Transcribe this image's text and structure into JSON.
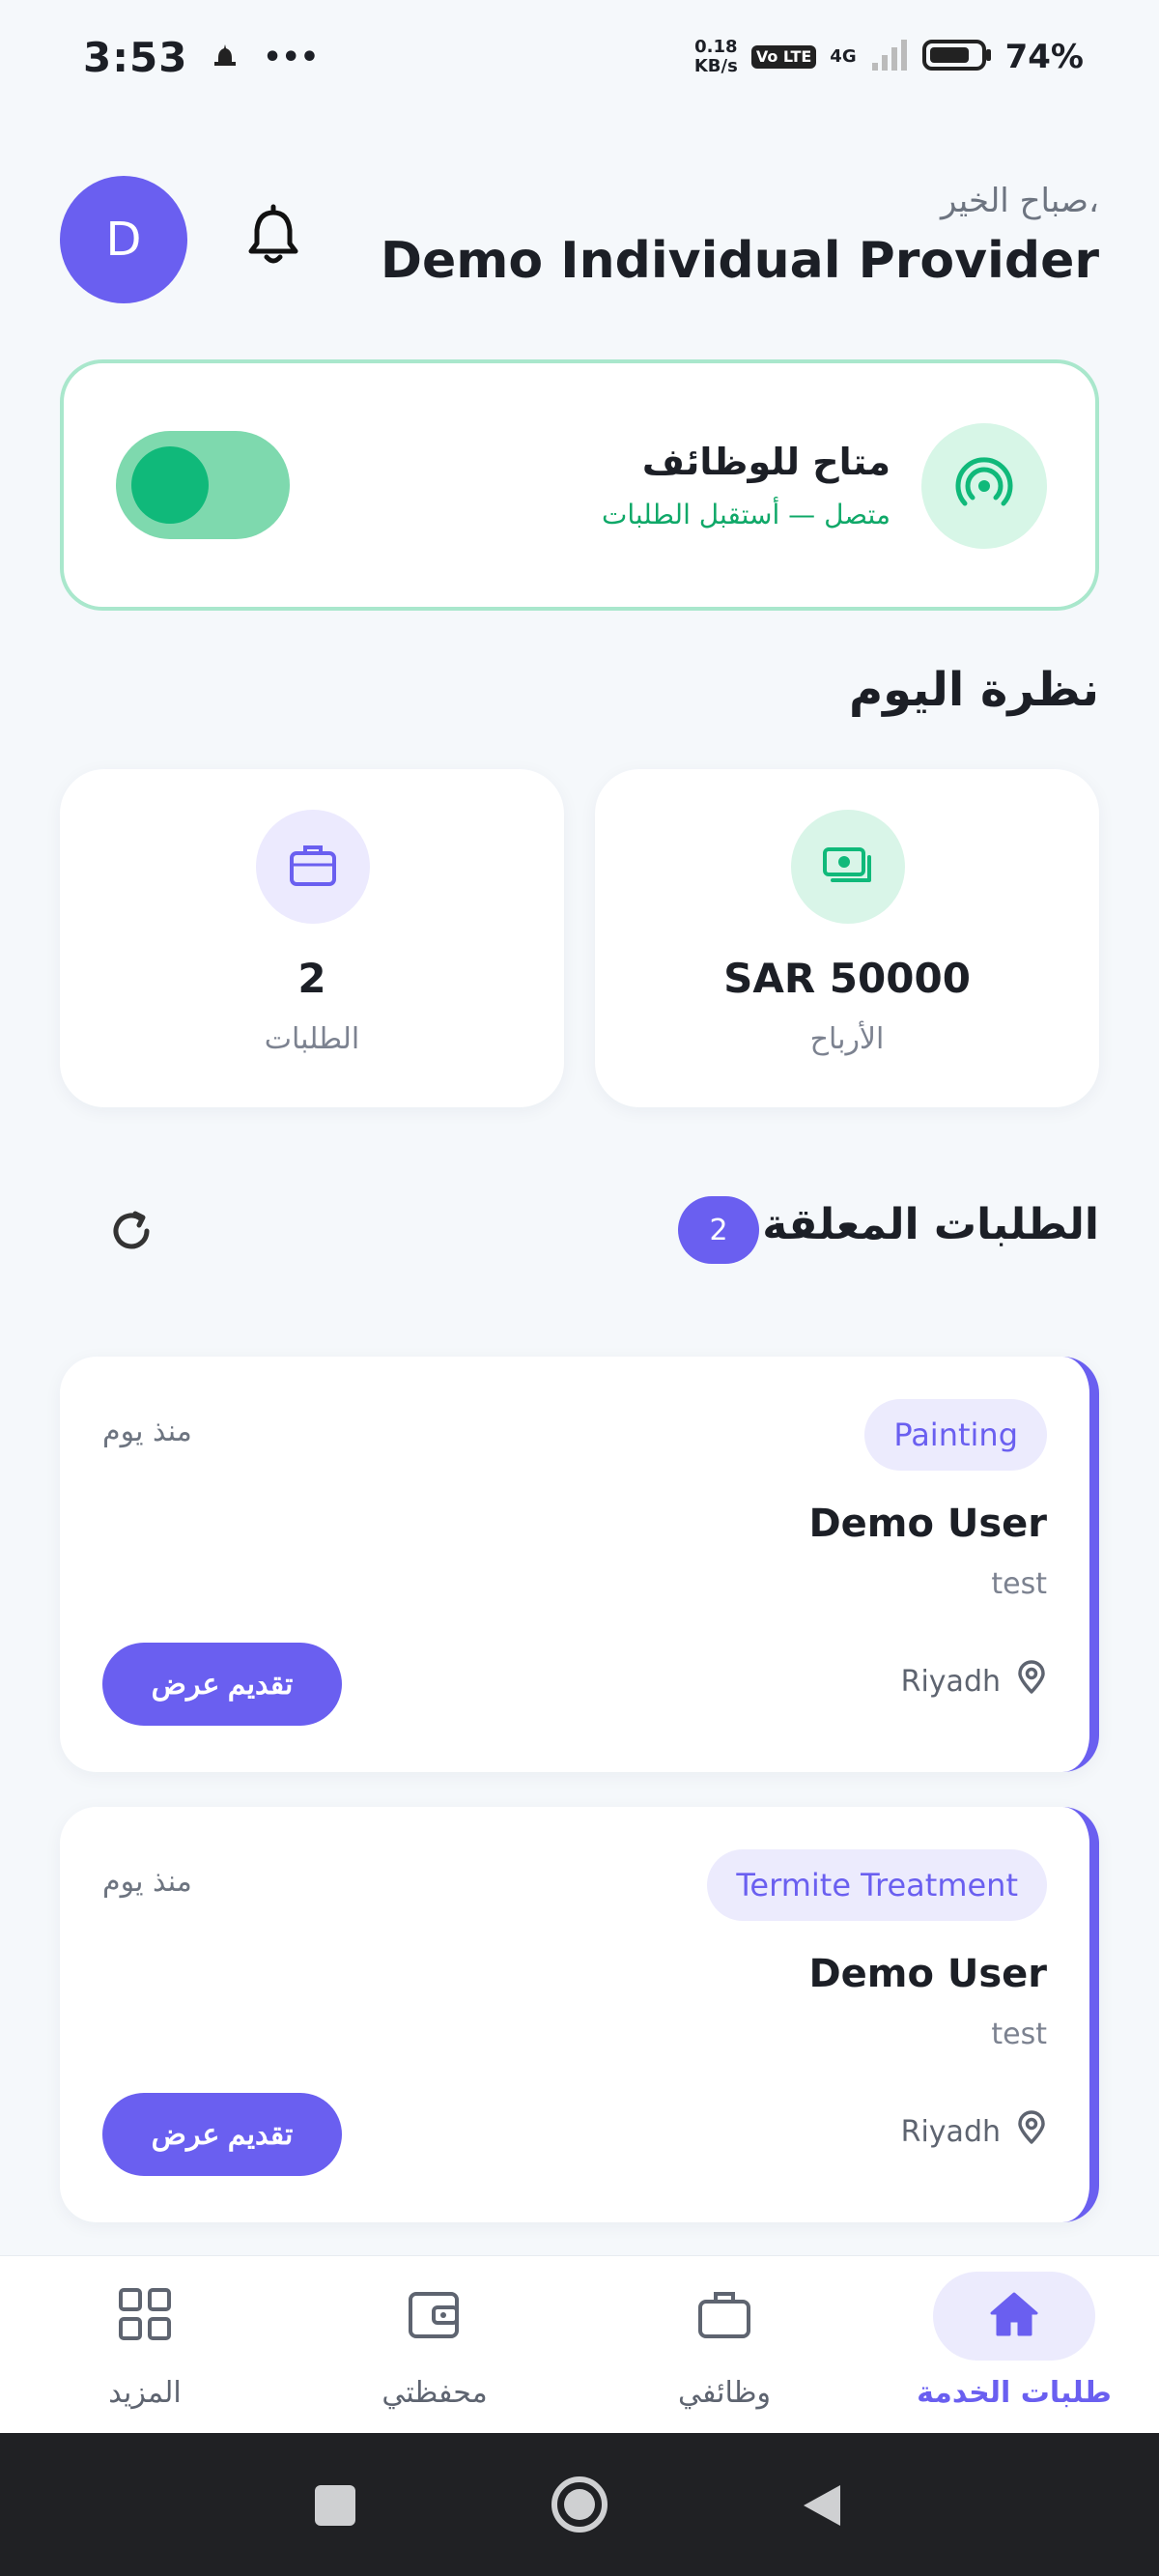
{
  "status_bar": {
    "time": "3:53",
    "notification_icons": "•••",
    "net_speed_value": "0.18",
    "net_speed_unit": "KB/s",
    "volte": "Vo LTE",
    "network": "4G",
    "battery": "74%"
  },
  "header": {
    "avatar_letter": "D",
    "greeting": "صباح الخير،",
    "provider_name": "Demo Individual Provider"
  },
  "availability": {
    "title": "متاح للوظائف",
    "subtitle": "متصل — أستقبل الطلبات",
    "toggle_on": true
  },
  "today": {
    "title": "نظرة اليوم",
    "earnings": {
      "value": "SAR 50000",
      "label": "الأرباح"
    },
    "requests": {
      "value": "2",
      "label": "الطلبات"
    }
  },
  "pending": {
    "title": "الطلبات المعلقة",
    "count": "2",
    "requests": [
      {
        "service": "Painting",
        "time_ago": "منذ يوم",
        "user": "Demo User",
        "description": "test",
        "location": "Riyadh",
        "action": "تقديم عرض"
      },
      {
        "service": "Termite Treatment",
        "time_ago": "منذ يوم",
        "user": "Demo User",
        "description": "test",
        "location": "Riyadh",
        "action": "تقديم عرض"
      }
    ]
  },
  "bottom_nav": {
    "items": [
      {
        "label": "طلبات الخدمة",
        "icon": "home-icon",
        "active": true
      },
      {
        "label": "وظائفي",
        "icon": "briefcase-icon",
        "active": false
      },
      {
        "label": "محفظتي",
        "icon": "wallet-icon",
        "active": false
      },
      {
        "label": "المزيد",
        "icon": "grid-icon",
        "active": false
      }
    ]
  },
  "colors": {
    "primary": "#6a5ff0",
    "success": "#10b97a",
    "background": "#f5f8fb"
  }
}
